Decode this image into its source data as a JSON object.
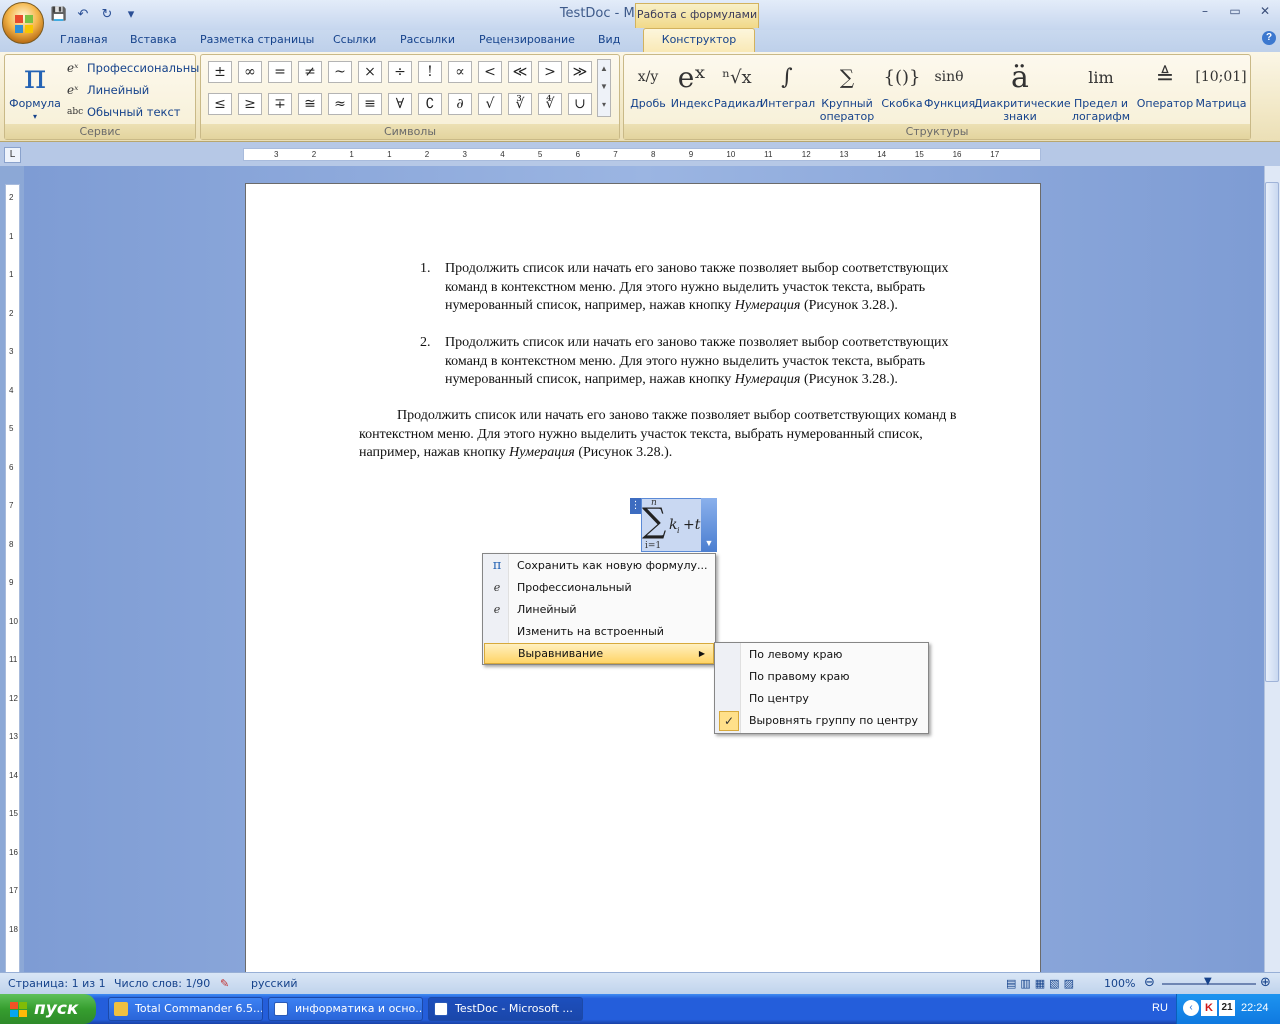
{
  "window": {
    "title": "TestDoc - Microsoft Word",
    "context_group": "Работа с формулами",
    "minimize": "–",
    "maximize": "▭",
    "close": "✕"
  },
  "tabs": [
    "Главная",
    "Вставка",
    "Разметка страницы",
    "Ссылки",
    "Рассылки",
    "Рецензирование",
    "Вид"
  ],
  "active_tab": "Конструктор",
  "ribbon": {
    "service": {
      "label": "Сервис",
      "formula_label": "Формула",
      "professional": "Профессиональный",
      "linear": "Линейный",
      "normal_text": "Обычный текст"
    },
    "symbols": {
      "label": "Символы",
      "row1": [
        "±",
        "∞",
        "=",
        "≠",
        "~",
        "×",
        "÷",
        "!",
        "∝",
        "<",
        "≪",
        ">",
        "≫"
      ],
      "row2": [
        "≤",
        "≥",
        "∓",
        "≅",
        "≈",
        "≡",
        "∀",
        "∁",
        "∂",
        "√",
        "∛",
        "∜",
        "∪"
      ]
    },
    "structures": {
      "label": "Структуры",
      "items": [
        {
          "label": "Дробь",
          "icon": "x/y"
        },
        {
          "label": "Индекс",
          "icon": "eˣ"
        },
        {
          "label": "Радикал",
          "icon": "ⁿ√x"
        },
        {
          "label": "Интеграл",
          "icon": "∫"
        },
        {
          "label": "Крупный оператор",
          "icon": "∑"
        },
        {
          "label": "Скобка",
          "icon": "{()}"
        },
        {
          "label": "Функция",
          "icon": "sinθ"
        },
        {
          "label": "Диакритические знаки",
          "icon": "ä"
        },
        {
          "label": "Предел и логарифм",
          "icon": "lim"
        },
        {
          "label": "Оператор",
          "icon": "≜"
        },
        {
          "label": "Матрица",
          "icon": "[10;01]"
        }
      ]
    }
  },
  "ruler": {
    "marks": [
      "3",
      "2",
      "1",
      "1",
      "2",
      "3",
      "4",
      "5",
      "6",
      "7",
      "8",
      "9",
      "10",
      "11",
      "12",
      "13",
      "14",
      "15",
      "16",
      "17"
    ],
    "vmarks": [
      "2",
      "1",
      "1",
      "2",
      "3",
      "4",
      "5",
      "6",
      "7",
      "8",
      "9",
      "10",
      "11",
      "12",
      "13",
      "14",
      "15",
      "16",
      "17",
      "18"
    ]
  },
  "document": {
    "list": [
      {
        "num": "1.",
        "text": "Продолжить список или начать его заново также позволяет выбор соответствующих команд в контекстном меню. Для этого нужно выделить участок текста, выбрать нумерованный список, например, нажав кнопку",
        "italic": "Нумерация",
        "tail": " (Рисунок 3.28.)."
      },
      {
        "num": "2.",
        "text": "Продолжить список или начать его заново также позволяет выбор соответствующих команд в контекстном меню. Для этого нужно выделить участок текста, выбрать нумерованный список, например, нажав кнопку",
        "italic": "Нумерация",
        "tail": " (Рисунок 3.28.)."
      }
    ],
    "paragraph": {
      "text": "Продолжить список или начать его заново также позволяет выбор соответствующих команд в контекстном меню. Для этого нужно выделить участок текста, выбрать нумерованный список, например, нажав кнопку ",
      "italic": "Нумерация",
      "tail": " (Рисунок 3.28.)."
    },
    "equation": {
      "upper": "n",
      "lower": "i=1",
      "body": "k",
      "sub": "i",
      "rest": "+t"
    }
  },
  "context_menu": {
    "items": [
      {
        "label": "Сохранить как новую формулу...",
        "icon": "π"
      },
      {
        "label": "Профессиональный",
        "icon": "e"
      },
      {
        "label": "Линейный",
        "icon": "e"
      },
      {
        "label": "Изменить на встроенный",
        "icon": ""
      },
      {
        "label": "Выравнивание",
        "icon": ""
      }
    ],
    "submenu": [
      "По левому краю",
      "По правому краю",
      "По центру",
      "Выровнять группу по центру"
    ]
  },
  "status": {
    "page": "Страница: 1 из 1",
    "words": "Число слов: 1/90",
    "language": "русский",
    "zoom": "100%"
  },
  "taskbar": {
    "start": "пуск",
    "tasks": [
      "Total Commander 6.5...",
      "информатика и осно...",
      "TestDoc - Microsoft ..."
    ],
    "lang": "RU",
    "clock": "22:24",
    "tray_num": "21"
  },
  "colors": {
    "accent": "#15428b",
    "context": "#f1d988",
    "taskbar": "#245edb"
  }
}
